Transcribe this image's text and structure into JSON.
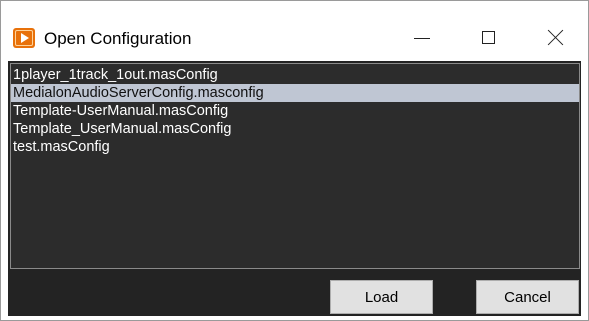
{
  "window": {
    "title": "Open Configuration",
    "icon": "app-play-icon",
    "controls": {
      "minimize": "minimize-icon",
      "maximize": "maximize-icon",
      "close": "close-icon"
    }
  },
  "file_list": {
    "items": [
      {
        "name": "1player_1track_1out.masConfig",
        "selected": false
      },
      {
        "name": "MedialonAudioServerConfig.masconfig",
        "selected": true
      },
      {
        "name": "Template-UserManual.masConfig",
        "selected": false
      },
      {
        "name": "Template_UserManual.masConfig",
        "selected": false
      },
      {
        "name": "test.masConfig",
        "selected": false
      }
    ]
  },
  "buttons": {
    "load_label": "Load",
    "cancel_label": "Cancel"
  },
  "colors": {
    "background": "#232323",
    "list_background": "#2c2c2c",
    "selection": "#bfc6d3",
    "icon_accent": "#e8710a"
  }
}
